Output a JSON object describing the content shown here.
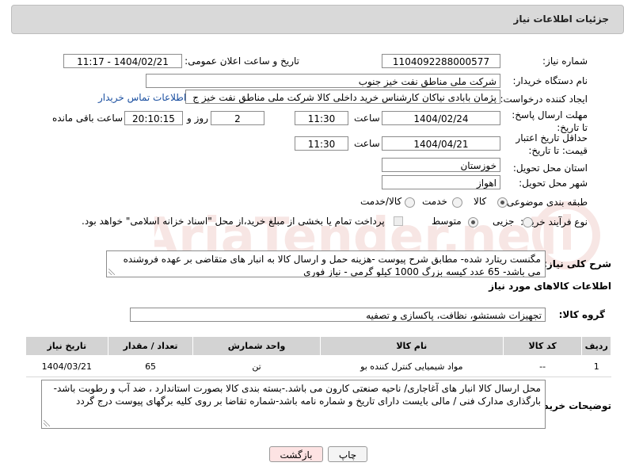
{
  "header": {
    "title": "جزئیات اطلاعات نیاز"
  },
  "labels": {
    "need_number": "شماره نیاز:",
    "announce_datetime": "تاریخ و ساعت اعلان عمومی:",
    "buyer_org": "نام دستگاه خریدار:",
    "request_creator": "ایجاد کننده درخواست:",
    "reply_deadline": "مهلت ارسال پاسخ: تا تاریخ:",
    "time": "ساعت",
    "day_and": "روز و",
    "hours_remaining": "ساعت باقی مانده",
    "price_validity": "حداقل تاریخ اعتبار قیمت: تا تاریخ:",
    "time2": "ساعت",
    "delivery_province": "استان محل تحویل:",
    "delivery_city": "شهر محل تحویل:",
    "category": "طبقه بندی موضوعی:",
    "purchase_type": "نوع فرآیند خرید :",
    "general_desc": "شرح کلی نیاز:",
    "goods_info_heading": "اطلاعات کالاهای مورد نیاز",
    "goods_group": "گروه کالا:",
    "buyer_notes": "توضیحات خریدار:"
  },
  "values": {
    "need_number": "1104092288000577",
    "announce_datetime": "1404/02/21 - 11:17",
    "buyer_org": "شرکت ملی مناطق نفت خیز جنوب",
    "request_creator": "پژمان  بابادی نیاکان  کارشناس خرید داخلی کالا  شرکت ملی مناطق نفت خیز ج",
    "contact_link": "اطلاعات تماس خریدار",
    "reply_date": "1404/02/24",
    "reply_time": "11:30",
    "days": "2",
    "remaining_time": "20:10:15",
    "price_date": "1404/04/21",
    "price_time": "11:30",
    "province": "خوزستان",
    "city": "اهواز",
    "general_desc": "مگنست ریتارد شده- مطابق شرح پیوست -هزینه حمل و ارسال کالا به انبار های  متقاضی بر عهده فروشنده می باشد- 65 عدد کیسه بزرگ 1000 کیلو گرمی - نیاز فوری",
    "goods_group": "تجهیزات شستشو، نظافت، پاکسازی و تصفیه",
    "buyer_notes": "محل ارسال کالا انبار های آغاجاری/ ناحیه صنعتی کارون می باشد.-بسته بندی کالا بصورت استاندارد ، ضد آب و رطوبت باشد-بارگذاری مدارک  فنی / مالی بایست دارای تاریخ و شماره نامه باشد-شماره تقاضا بر روی کلیه برگهای پیوست درج گردد"
  },
  "category_options": [
    "کالا",
    "خدمت",
    "کالا/خدمت"
  ],
  "category_selected": "کالا",
  "purchase_options": [
    "جزیی",
    "متوسط"
  ],
  "purchase_selected": "متوسط",
  "payment_note": "پرداخت تمام یا بخشی از مبلغ خرید،از محل \"اسناد خزانه اسلامی\" خواهد بود.",
  "table": {
    "headers": [
      "ردیف",
      "کد کالا",
      "نام کالا",
      "واحد شمارش",
      "تعداد / مقدار",
      "تاریخ نیاز"
    ],
    "rows": [
      [
        "1",
        "--",
        "مواد شیمیایی کنترل کننده بو",
        "تن",
        "65",
        "1404/03/21"
      ]
    ]
  },
  "buttons": {
    "print": "چاپ",
    "back": "بازگشت"
  },
  "watermark": {
    "text": "AriaTender.neT"
  },
  "colors": {
    "link": "#1a4fa0",
    "back_button_bg": "#fde3e3",
    "watermark": "#c0392b"
  }
}
